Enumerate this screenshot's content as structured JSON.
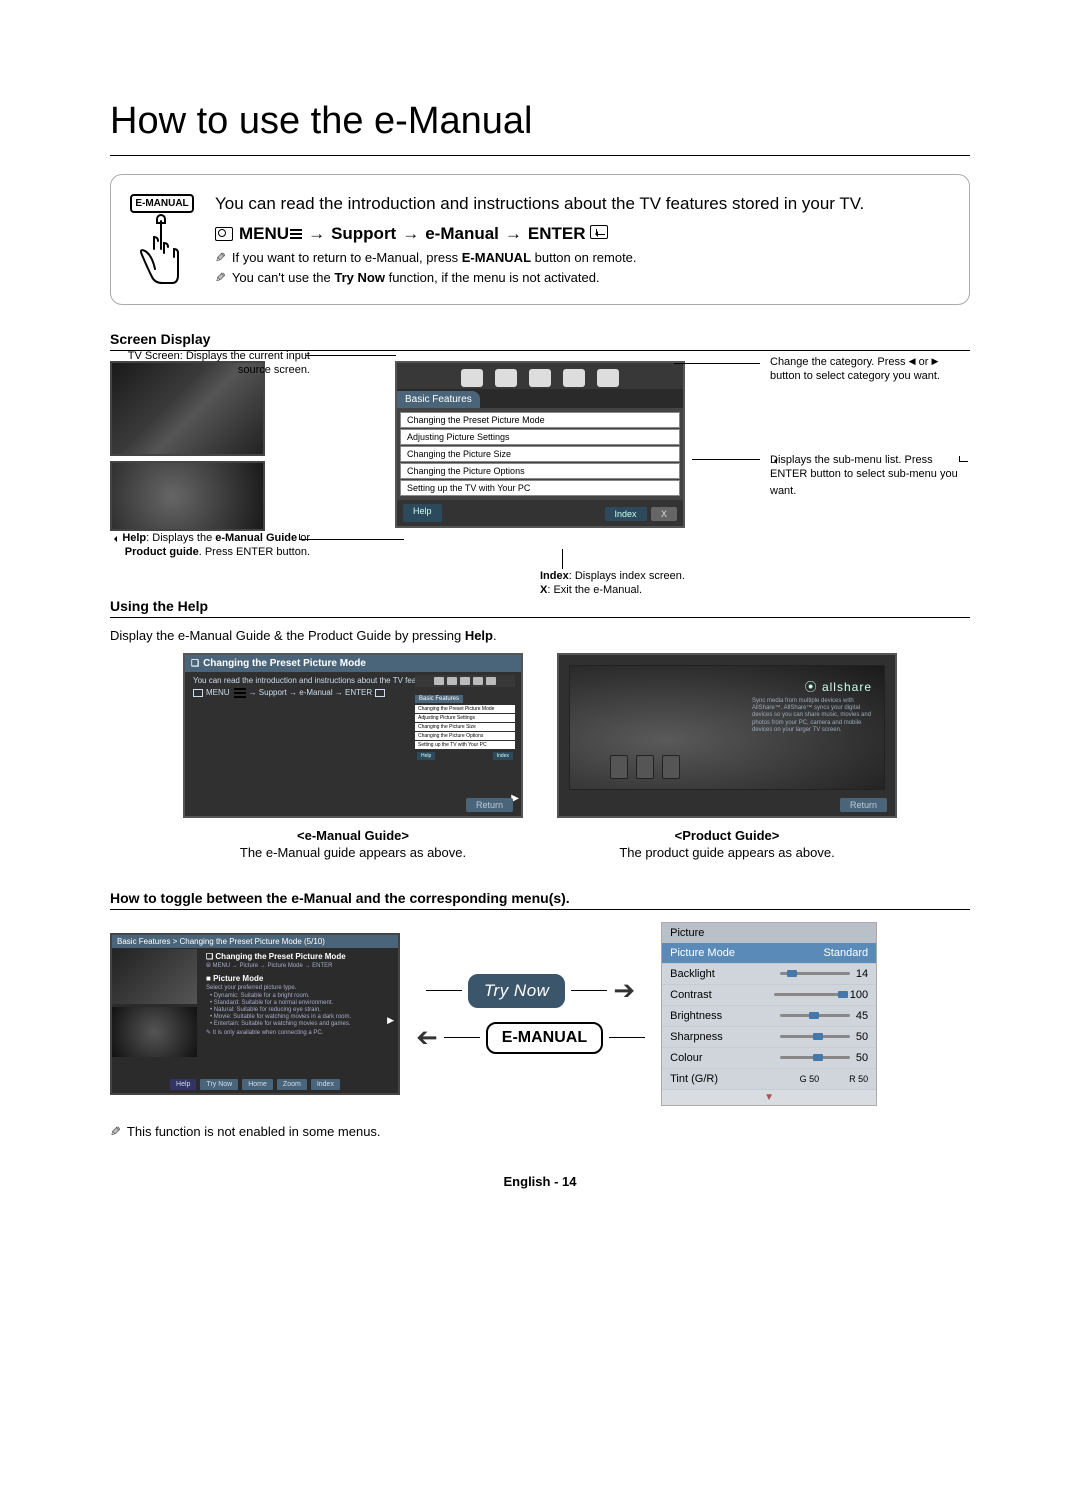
{
  "page": {
    "title": "How to use the e-Manual",
    "footer": "English - 14"
  },
  "intro": {
    "icon_label": "E-MANUAL",
    "text": "You can read the introduction and instructions about the TV features stored in your TV.",
    "nav": {
      "menu": "MENU",
      "arrow": "→",
      "support": "Support",
      "emanual": "e-Manual",
      "enter": "ENTER"
    },
    "note1_a": "If you want to return to e-Manual, press ",
    "note1_b": "E-MANUAL",
    "note1_c": " button on remote.",
    "note2_a": "You can't use the ",
    "note2_b": "Try Now",
    "note2_c": " function, if the menu is not activated."
  },
  "screen_display": {
    "heading": "Screen Display",
    "tab": "Basic Features",
    "rows": [
      "Changing the Preset Picture Mode",
      "Adjusting Picture Settings",
      "Changing the Picture Size",
      "Changing the Picture Options",
      "Setting up the TV with Your PC"
    ],
    "btn_help": "Help",
    "btn_index": "Index",
    "btn_x": "X",
    "callout_tv": "TV Screen: Displays the current input source screen.",
    "callout_help_a": "Help",
    "callout_help_b": ": Displays the ",
    "callout_help_c": "e-Manual Guide",
    "callout_help_d": " or ",
    "callout_help_e": "Product guide",
    "callout_help_f": ". Press ENTER",
    "callout_help_g": " button.",
    "callout_cat_a": "Change the category. Press ",
    "callout_cat_b": " or ",
    "callout_cat_c": " button to select category you want.",
    "callout_sub_a": "Displays the sub-menu list. Press ENTER",
    "callout_sub_b": " button to select sub-menu you want.",
    "callout_idx_a": "Index",
    "callout_idx_b": ": Displays index screen.",
    "callout_idx_c": "X",
    "callout_idx_d": ": Exit the e-Manual."
  },
  "help": {
    "heading": "Using the Help",
    "desc_a": "Display the e-Manual Guide & the Product Guide by pressing ",
    "desc_b": "Help",
    "desc_c": ".",
    "box1": {
      "title": "Changing the Preset Picture Mode",
      "line1": "You can read the introduction and instructions about the TV features stored in your TV.",
      "path_menu": "MENU",
      "path_mid": " → Support → e-Manual → ENTER",
      "mini_tab": "Basic Features",
      "mini_rows": [
        "Changing the Preset Picture Mode",
        "Adjusting Picture Settings",
        "Changing the Picture Size",
        "Changing the Picture Options",
        "Setting up the TV with Your PC"
      ],
      "mini_help": "Help",
      "mini_index": "Index",
      "return": "Return"
    },
    "box2": {
      "brand": "allshare",
      "desc": "Sync media from multiple devices with AllShare™. AllShare™ syncs your digital devices so you can share music, movies and photos from your PC, camera and mobile devices on your larger TV screen.",
      "return": "Return"
    },
    "label1_title": "<e-Manual Guide>",
    "label1_desc": "The e-Manual guide appears as above.",
    "label2_title": "<Product Guide>",
    "label2_desc": "The product guide appears as above."
  },
  "toggle": {
    "heading": "How to toggle between the e-Manual and the corresponding menu(s).",
    "left": {
      "breadcrumb": "Basic Features > Changing the Preset Picture Mode (5/10)",
      "head": "Changing the Preset Picture Mode",
      "path": "MENU → Picture → Picture Mode → ENTER",
      "pm_label": "Picture Mode",
      "pm_sub": "Select your preferred picture type.",
      "items": [
        "Dynamic: Suitable for a bright room.",
        "Standard: Suitable for a normal environment.",
        "Natural: Suitable for reducing eye strain.",
        "Movie: Suitable for watching movies in a dark room.",
        "Entertain: Suitable for watching movies and games."
      ],
      "sub_note": "It is only available when connecting a PC.",
      "foot_help": "Help",
      "foot_try": "Try Now",
      "foot_home": "Home",
      "foot_zoom": "Zoom",
      "foot_index": "Index"
    },
    "pill_try": "Try Now",
    "pill_eman": "E-MANUAL",
    "right": {
      "head": "Picture",
      "rows": [
        {
          "label": "Picture Mode",
          "val": "Standard",
          "sel": true
        },
        {
          "label": "Backlight",
          "val": "14",
          "cls": "sl-14"
        },
        {
          "label": "Contrast",
          "val": "100",
          "cls": "sl-100"
        },
        {
          "label": "Brightness",
          "val": "45",
          "cls": "sl-45"
        },
        {
          "label": "Sharpness",
          "val": "50",
          "cls": "sl-50"
        },
        {
          "label": "Colour",
          "val": "50",
          "cls": "sl-50"
        }
      ],
      "tint_label": "Tint (G/R)",
      "tint_val": "G 50            R 50"
    },
    "note": "This function is not enabled in some menus."
  }
}
